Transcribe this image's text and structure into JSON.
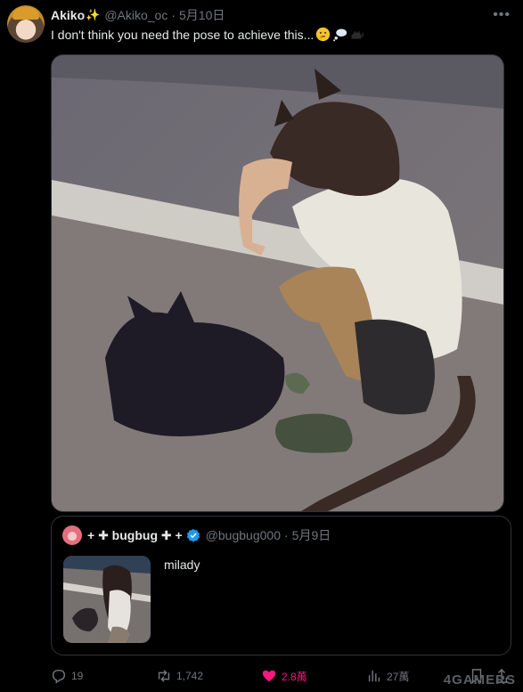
{
  "tweet": {
    "author_name": "Akiko",
    "author_handle": "@Akiko_oc",
    "date": "5月10日",
    "separator": "·",
    "text": "I don't think you need the pose to achieve this...",
    "sparkle_emoji": "✨",
    "emojis": [
      "thinking-face",
      "thought-balloon",
      "black-cat"
    ]
  },
  "quote": {
    "author_name": "+ ✚ bugbug ✚ +",
    "author_handle": "@bugbug000",
    "date": "5月9日",
    "separator": "·",
    "text": "milady"
  },
  "actions": {
    "replies": "19",
    "reposts": "1,742",
    "likes": "2.8萬",
    "views": "27萬"
  },
  "watermark": "4GAMERS",
  "colors": {
    "background": "#000000",
    "text": "#e7e9ea",
    "muted": "#71767b",
    "like": "#f91880",
    "verified": "#1d9bf0"
  }
}
